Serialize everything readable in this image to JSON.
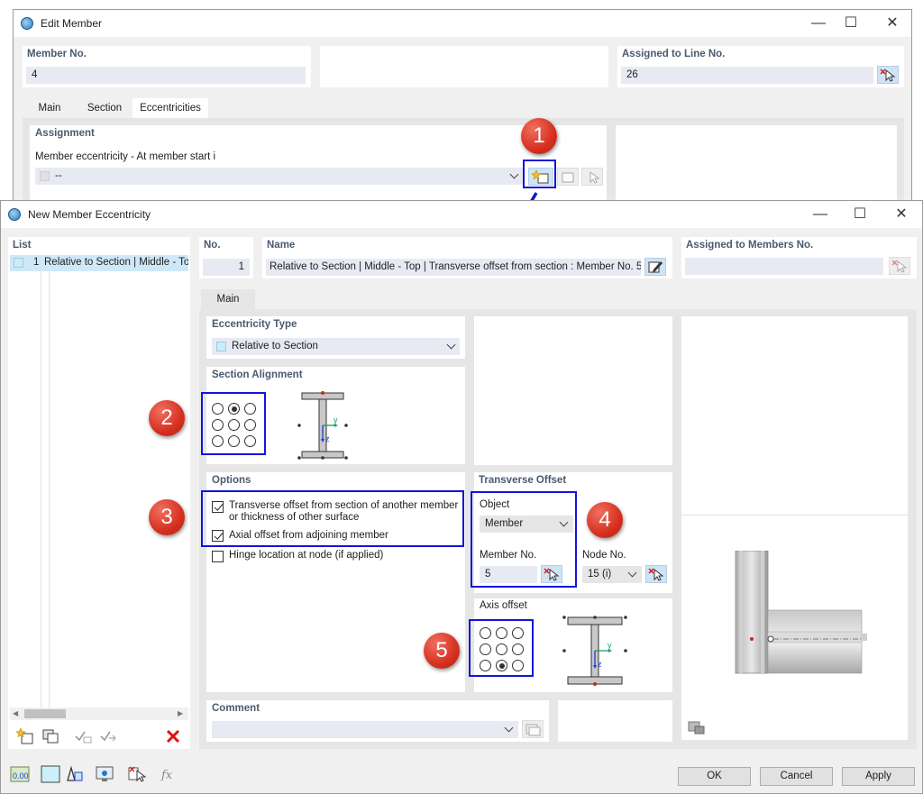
{
  "edit_member": {
    "title": "Edit Member",
    "member_no_label": "Member No.",
    "member_no_value": "4",
    "assigned_line_label": "Assigned to Line No.",
    "assigned_line_value": "26",
    "tabs": [
      "Main",
      "Section",
      "Eccentricities"
    ],
    "assignment_label": "Assignment",
    "ecc_start_label": "Member eccentricity - At member start i",
    "ecc_start_value": "--"
  },
  "dialog": {
    "title": "New Member Eccentricity",
    "list_label": "List",
    "list_items": [
      {
        "no": "1",
        "name": "Relative to Section | Middle - To"
      }
    ],
    "no_label": "No.",
    "no_value": "1",
    "name_label": "Name",
    "name_value": "Relative to Section | Middle - Top | Transverse offset from section : Member No. 5",
    "assigned_members_label": "Assigned to Members No.",
    "assigned_members_value": "",
    "main_tab": "Main",
    "ecc_type_label": "Eccentricity Type",
    "ecc_type_value": "Relative to Section",
    "section_alignment_label": "Section Alignment",
    "section_alignment_selected": [
      0,
      1
    ],
    "options_label": "Options",
    "options": [
      {
        "label": "Transverse offset from section of another member",
        "label2": "or thickness of other surface",
        "checked": true
      },
      {
        "label": "Axial offset from adjoining member",
        "checked": true
      },
      {
        "label": "Hinge location at node (if applied)",
        "checked": false
      }
    ],
    "transverse_offset_label": "Transverse Offset",
    "object_label": "Object",
    "object_value": "Member",
    "member_no_label": "Member No.",
    "member_no_value": "5",
    "node_no_label": "Node No.",
    "node_no_value": "15 (i)",
    "axis_offset_label": "Axis offset",
    "axis_offset_selected": [
      2,
      1
    ],
    "comment_label": "Comment",
    "comment_value": "",
    "buttons": {
      "ok": "OK",
      "cancel": "Cancel",
      "apply": "Apply"
    },
    "axis_y": "y",
    "axis_z": "z"
  },
  "callouts": [
    "1",
    "2",
    "3",
    "4",
    "5"
  ],
  "colors": {
    "highlight": "#1414d8",
    "callout": "#d6301f",
    "field": "#e8eaf3",
    "accent_blue": "#cfe3f5"
  }
}
